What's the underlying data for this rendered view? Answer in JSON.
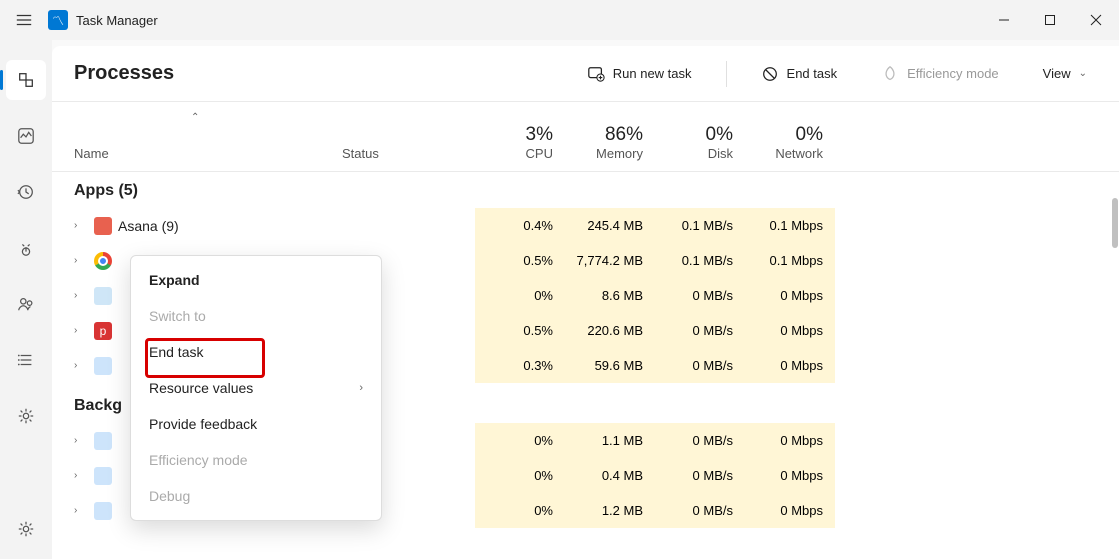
{
  "title": "Task Manager",
  "win": {
    "min": "min",
    "max": "max",
    "close": "close"
  },
  "sidebar": {
    "items": [
      {
        "name": "processes-tab"
      },
      {
        "name": "performance-tab"
      },
      {
        "name": "history-tab"
      },
      {
        "name": "startup-tab"
      },
      {
        "name": "users-tab"
      },
      {
        "name": "details-tab"
      },
      {
        "name": "services-tab"
      }
    ],
    "bottom": {
      "name": "settings-tab"
    }
  },
  "page_title": "Processes",
  "actions": {
    "run": "Run new task",
    "end": "End task",
    "eff": "Efficiency mode",
    "view": "View"
  },
  "columns": {
    "name": "Name",
    "status": "Status",
    "cpu_pct": "3%",
    "cpu": "CPU",
    "mem_pct": "86%",
    "mem": "Memory",
    "disk_pct": "0%",
    "disk": "Disk",
    "net_pct": "0%",
    "net": "Network"
  },
  "groups": {
    "apps": "Apps (5)",
    "bg": "Backg"
  },
  "rows": [
    {
      "icon": "#e8614f",
      "label": "Asana (9)",
      "cpu": "0.4%",
      "cpuH": "heat1",
      "mem": "245.4 MB",
      "memH": "heatB",
      "disk": "0.1 MB/s",
      "net": "0.1 Mbps"
    },
    {
      "icon_svg": "chrome",
      "label": "",
      "cpu": "0.5%",
      "cpuH": "heat1",
      "mem": "7,774.2 MB",
      "memH": "heatC",
      "disk": "0.1 MB/s",
      "net": "0.1 Mbps"
    },
    {
      "icon": "#7db0e0",
      "label": "",
      "cpu": "0%",
      "cpuH": "heat1",
      "mem": "8.6 MB",
      "memH": "heatA",
      "disk": "0 MB/s",
      "net": "0 Mbps"
    },
    {
      "icon": "#d83434",
      "label": "",
      "cpu": "0.5%",
      "cpuH": "heat1",
      "mem": "220.6 MB",
      "memH": "heatC",
      "disk": "0 MB/s",
      "net": "0 Mbps"
    },
    {
      "icon": "#0078d4",
      "label": "",
      "cpu": "0.3%",
      "cpuH": "heat1",
      "mem": "59.6 MB",
      "memH": "heatA",
      "disk": "0 MB/s",
      "net": "0 Mbps"
    }
  ],
  "bg_rows": [
    {
      "cpu": "0%",
      "mem": "1.1 MB",
      "disk": "0 MB/s",
      "net": "0 Mbps"
    },
    {
      "cpu": "0%",
      "mem": "0.4 MB",
      "disk": "0 MB/s",
      "net": "0 Mbps"
    },
    {
      "cpu": "0%",
      "mem": "1.2 MB",
      "disk": "0 MB/s",
      "net": "0 Mbps"
    }
  ],
  "ctx": {
    "expand": "Expand",
    "switch": "Switch to",
    "end": "End task",
    "resvals": "Resource values",
    "feedback": "Provide feedback",
    "eff": "Efficiency mode",
    "debug": "Debug"
  }
}
